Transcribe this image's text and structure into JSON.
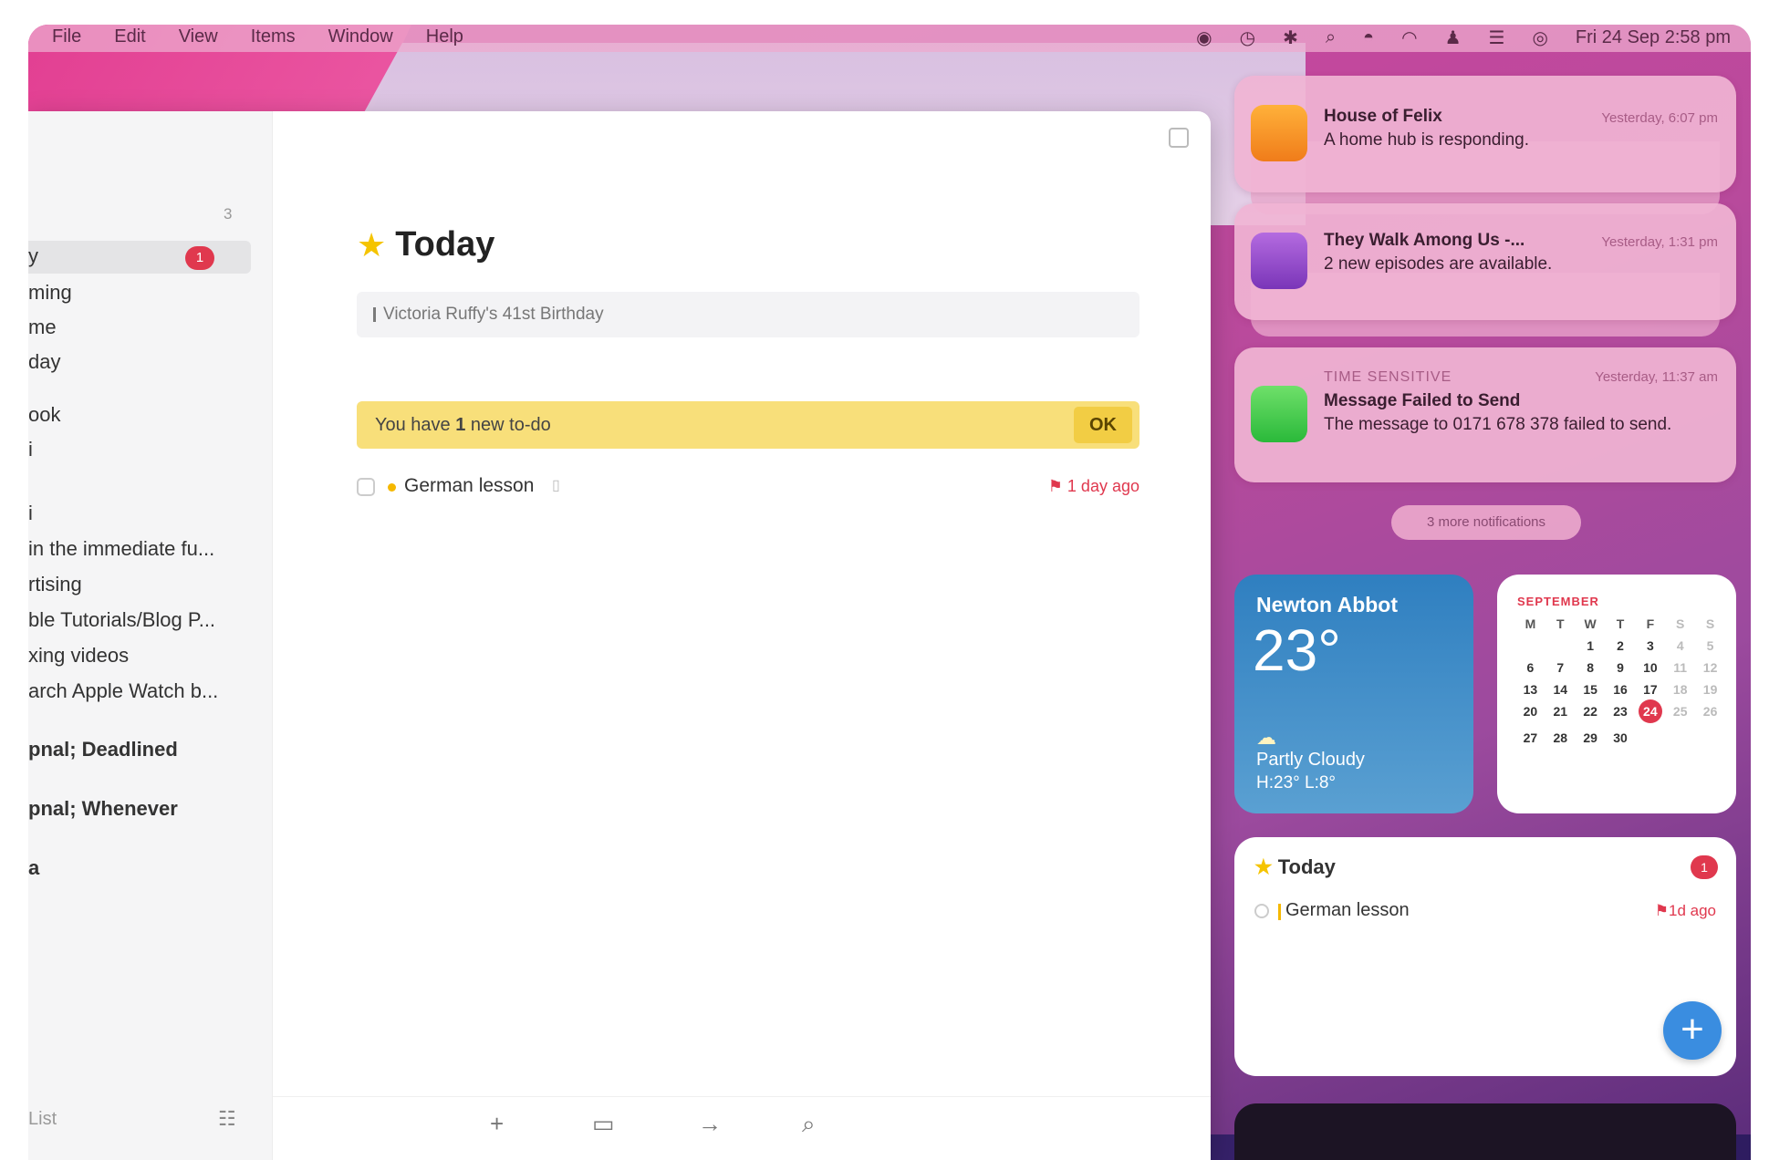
{
  "menubar": {
    "items": [
      "File",
      "Edit",
      "View",
      "Items",
      "Window",
      "Help"
    ],
    "datetime": "Fri 24 Sep 2:58 pm",
    "status_icons": [
      "user-icon",
      "time-machine-icon",
      "bluetooth-icon",
      "search-icon",
      "vpn-icon",
      "wifi-icon",
      "person-icon",
      "control-center-icon",
      "siri-icon"
    ]
  },
  "sidebar": {
    "count": "3",
    "items": [
      {
        "label": "y",
        "selected": true,
        "badge": "1"
      },
      {
        "label": "ming"
      },
      {
        "label": "me"
      },
      {
        "label": "day"
      },
      {
        "label": "ook"
      },
      {
        "label": "i"
      },
      {
        "label": "i"
      },
      {
        "label": "in the immediate fu..."
      },
      {
        "label": "rtising"
      },
      {
        "label": "ble Tutorials/Blog P..."
      },
      {
        "label": "xing videos"
      },
      {
        "label": "arch Apple Watch b..."
      },
      {
        "label": "pnal; Deadlined"
      },
      {
        "label": "pnal; Whenever"
      },
      {
        "label": "a"
      }
    ],
    "footer_label": "List"
  },
  "main": {
    "title": "Today",
    "event": "Victoria Ruffy's 41st Birthday",
    "notice_prefix": "You have ",
    "notice_count": "1",
    "notice_suffix": " new to-do",
    "notice_ok": "OK",
    "task_name": "German lesson",
    "task_due": "1 day ago",
    "toolbar_icons": [
      "plus-icon",
      "calendar-icon",
      "arrow-right-icon",
      "search-icon"
    ]
  },
  "notifications": [
    {
      "title": "House of Felix",
      "body": "A home hub is responding.",
      "time": "Yesterday, 6:07 pm",
      "icon": "home-icon"
    },
    {
      "title": "They Walk Among Us -...",
      "body": "2 new episodes are available.",
      "time": "Yesterday, 1:31 pm",
      "icon": "podcasts-icon"
    },
    {
      "label": "TIME SENSITIVE",
      "title": "Message Failed to Send",
      "body": "The message to 0171 678 378 failed to send.",
      "time": "Yesterday, 11:37 am",
      "icon": "messages-icon"
    }
  ],
  "more_notifications": "3 more notifications",
  "weather": {
    "city": "Newton Abbot",
    "temp": "23°",
    "condition": "Partly Cloudy",
    "hilo": "H:23° L:8°"
  },
  "calendar": {
    "month": "SEPTEMBER",
    "days_header": [
      "M",
      "T",
      "W",
      "T",
      "F",
      "S",
      "S"
    ],
    "weeks": [
      [
        "",
        "",
        "1",
        "2",
        "3",
        "4",
        "5"
      ],
      [
        "6",
        "7",
        "8",
        "9",
        "10",
        "11",
        "12"
      ],
      [
        "13",
        "14",
        "15",
        "16",
        "17",
        "18",
        "19"
      ],
      [
        "20",
        "21",
        "22",
        "23",
        "24",
        "25",
        "26"
      ],
      [
        "27",
        "28",
        "29",
        "30",
        "",
        "",
        ""
      ]
    ],
    "today": "24"
  },
  "today_widget": {
    "title": "Today",
    "badge": "1",
    "task": "German lesson",
    "due": "1d ago"
  },
  "colors": {
    "accent_red": "#e0384e",
    "star_yellow": "#f5c400",
    "notice_yellow": "#f8df7a",
    "add_blue": "#3a8de0"
  }
}
